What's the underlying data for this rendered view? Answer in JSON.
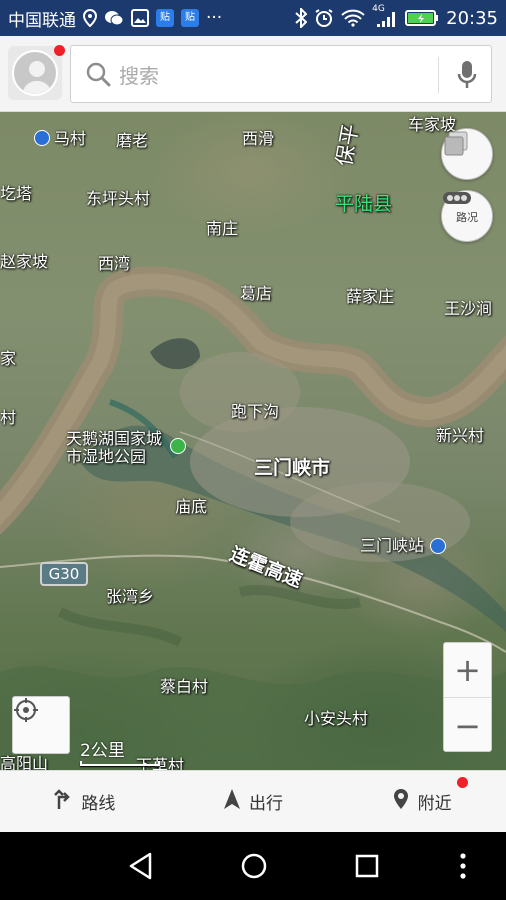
{
  "status_bar": {
    "carrier": "中国联通",
    "network": "4G",
    "time": "20:35",
    "icons": [
      "location-icon",
      "wechat-icon",
      "gallery-icon",
      "tieba-icon",
      "tieba-icon",
      "more-notifications-icon",
      "bluetooth-icon",
      "alarm-icon",
      "wifi-icon",
      "signal-icon",
      "battery-icon"
    ],
    "tieba_label": "贴",
    "more": "···"
  },
  "search": {
    "placeholder": "搜索"
  },
  "map": {
    "labels": {
      "macun": "马村",
      "molao": "磨老",
      "xihua": "西滑",
      "baoping": "保平",
      "chejiapo": "车家坡",
      "geta": "圪塔",
      "dongpingtoucun": "东坪头村",
      "pingluxian": "平陆县",
      "nanzhuang": "南庄",
      "zhaojiapo": "赵家坡",
      "xiwan": "西湾",
      "gedian": "葛店",
      "xuejiazhuang": "薛家庄",
      "wangshajian": "王沙涧",
      "jia": "家",
      "cun": "村",
      "paoxiagou": "跑下沟",
      "xinxingcun": "新兴村",
      "tianehu": "天鹅湖国家城\n市湿地公园",
      "sanmenxia": "三门峡市",
      "miaodi": "庙底",
      "sanmenxiazhan": "三门峡站",
      "lianhuo": "连霍高速",
      "zhangwanxiang": "张湾乡",
      "caibaicun": "蔡白村",
      "xiaoantoucun": "小安头村",
      "gaoyangshan": "高阳山",
      "xiacaocun": "下草村"
    },
    "road_shield": "G30",
    "layers_button_label": "",
    "traffic_button_label": "路况",
    "zoom_in": "+",
    "zoom_out": "−",
    "scale_label": "2公里"
  },
  "tabs": [
    {
      "label": "路线",
      "icon": "route-icon"
    },
    {
      "label": "出行",
      "icon": "navigation-arrow-icon"
    },
    {
      "label": "附近",
      "icon": "location-pin-icon"
    }
  ],
  "colors": {
    "status_bar_bg": "#1c3a6e",
    "county_label": "#3ee07a",
    "notification_dot": "#f0202a",
    "river": "#9a8c72"
  }
}
